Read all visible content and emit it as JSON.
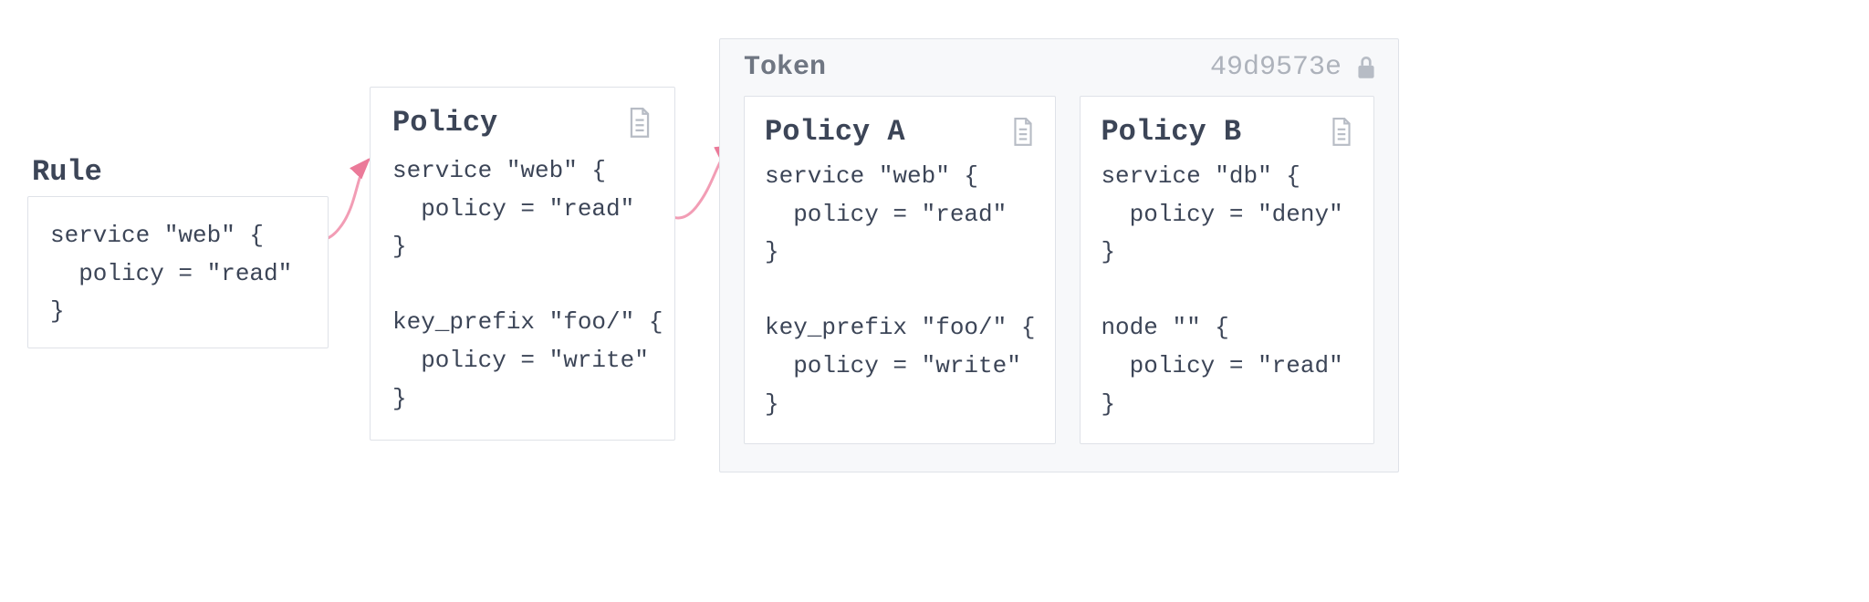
{
  "colors": {
    "border": "#dfe2e8",
    "text": "#3c4557",
    "muted": "#6f7682",
    "icon": "#b7bcc5",
    "token_bg": "#f7f8fa",
    "arrow": "#f29db5",
    "arrow_head": "#eb7a99"
  },
  "rule": {
    "title": "Rule",
    "code": "service \"web\" {\n  policy = \"read\"\n}"
  },
  "policy": {
    "title": "Policy",
    "icon": "file-text-icon",
    "code": "service \"web\" {\n  policy = \"read\"\n}\n\nkey_prefix \"foo/\" {\n  policy = \"write\"\n}"
  },
  "token": {
    "title": "Token",
    "id": "49d9573e",
    "lock_icon": "lock-icon",
    "policies": [
      {
        "title": "Policy A",
        "icon": "file-text-icon",
        "code": "service \"web\" {\n  policy = \"read\"\n}\n\nkey_prefix \"foo/\" {\n  policy = \"write\"\n}"
      },
      {
        "title": "Policy B",
        "icon": "file-text-icon",
        "code": "service \"db\" {\n  policy = \"deny\"\n}\n\nnode \"\" {\n  policy = \"read\"\n}"
      }
    ]
  }
}
